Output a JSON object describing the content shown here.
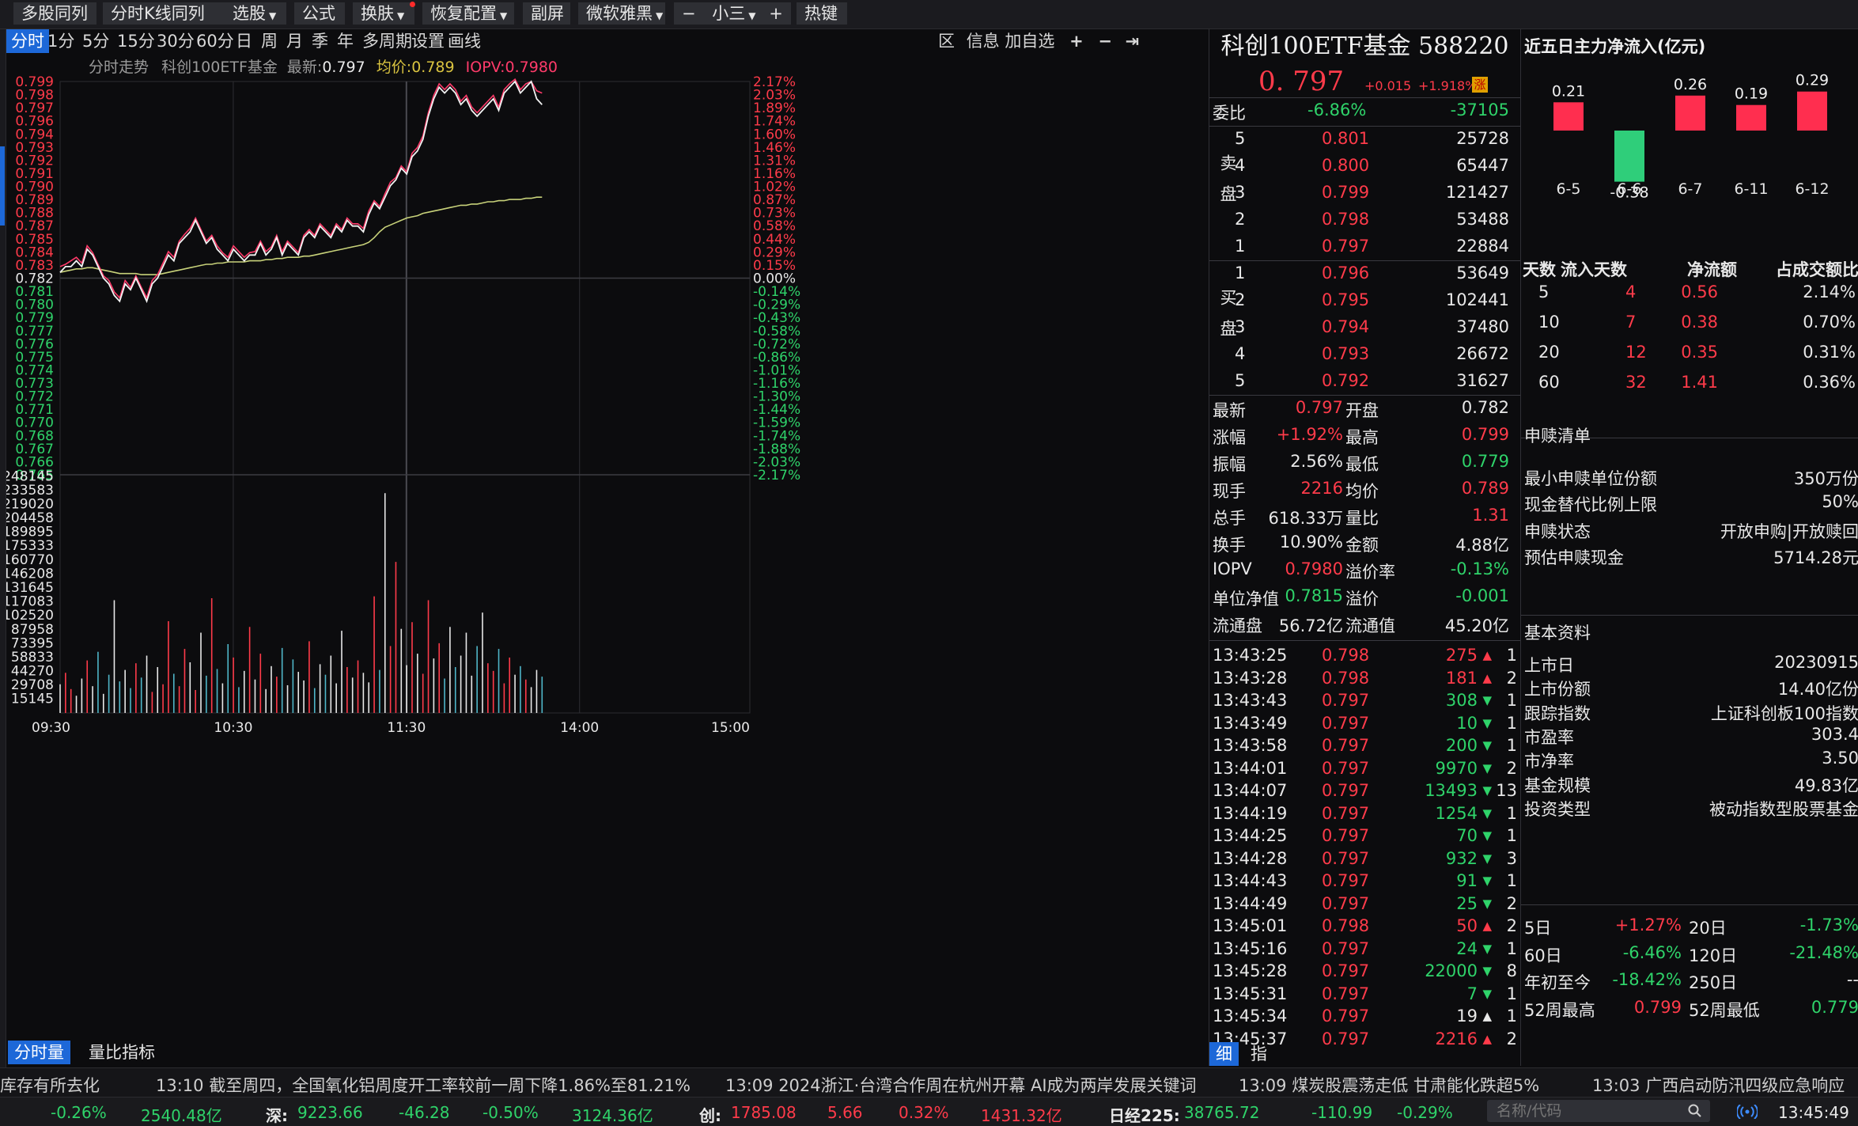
{
  "colors": {
    "up": "#ff3b4a",
    "down": "#2fd36a",
    "accent": "#1d68d8",
    "price_line": "#f2f2f2",
    "iopv_line": "#ff3b6a",
    "avg_line": "#c8d27a"
  },
  "toolbar": {
    "buttons": [
      {
        "label": "多股同列",
        "dropdown": false
      },
      {
        "label": "分时K线同列",
        "dropdown": false
      },
      {
        "label": "选股",
        "dropdown": true
      },
      {
        "label": "公式",
        "dropdown": false
      },
      {
        "label": "换肤",
        "dropdown": true
      },
      {
        "label": "恢复配置",
        "dropdown": true
      },
      {
        "label": "副屏",
        "dropdown": false
      },
      {
        "label": "微软雅黑",
        "dropdown": true
      },
      {
        "label": "小三",
        "dropdown": true
      },
      {
        "label": "热键",
        "dropdown": false
      }
    ],
    "minus": "−",
    "plus": "+"
  },
  "period_tabs": [
    "分时",
    "1分",
    "5分",
    "15分",
    "30分",
    "60分",
    "日",
    "周",
    "月",
    "季",
    "年",
    "多周期",
    "设置",
    "画线"
  ],
  "chart_toolbar": {
    "zone": "区",
    "info": "信息",
    "add_watch": "加自选",
    "plus": "+",
    "minus": "−",
    "arrow": "⇥"
  },
  "chart_header": {
    "title": "分时走势",
    "name": "科创100ETF基金",
    "latest_label": "最新:",
    "latest": "0.797",
    "avg_label": "均价:",
    "avg": "0.789",
    "iopv_label": "IOPV:",
    "iopv": "0.7980"
  },
  "chart_data": {
    "type": "line",
    "base_price": 0.782,
    "price_ticks": [
      "0.799",
      "0.798",
      "0.797",
      "0.796",
      "0.794",
      "0.793",
      "0.792",
      "0.791",
      "0.790",
      "0.789",
      "0.788",
      "0.787",
      "0.785",
      "0.784",
      "0.783",
      "0.782",
      "0.781",
      "0.780",
      "0.779",
      "0.777",
      "0.776",
      "0.775",
      "0.774",
      "0.773",
      "0.772",
      "0.771",
      "0.770",
      "0.768",
      "0.767",
      "0.766",
      "0.765"
    ],
    "pct_ticks": [
      "2.17%",
      "2.03%",
      "1.89%",
      "1.74%",
      "1.60%",
      "1.46%",
      "1.31%",
      "1.16%",
      "1.02%",
      "0.87%",
      "0.73%",
      "0.58%",
      "0.44%",
      "0.29%",
      "0.15%",
      "0.00%",
      "-0.14%",
      "-0.29%",
      "-0.43%",
      "-0.58%",
      "-0.72%",
      "-0.86%",
      "-1.01%",
      "-1.16%",
      "-1.30%",
      "-1.44%",
      "-1.59%",
      "-1.74%",
      "-1.88%",
      "-2.03%",
      "-2.17%"
    ],
    "volume_ticks": [
      "248145",
      "233583",
      "219020",
      "204458",
      "189895",
      "175333",
      "160770",
      "146208",
      "131645",
      "117083",
      "102520",
      "87958",
      "73395",
      "58833",
      "44270",
      "29708",
      "15145"
    ],
    "time_labels": [
      "09:30",
      "10:30",
      "11:30",
      "14:00",
      "15:00"
    ],
    "price_series": [
      0.7825,
      0.783,
      0.783,
      0.7835,
      0.783,
      0.7845,
      0.784,
      0.783,
      0.782,
      0.7815,
      0.7805,
      0.78,
      0.7815,
      0.781,
      0.782,
      0.781,
      0.78,
      0.7815,
      0.782,
      0.783,
      0.784,
      0.7835,
      0.785,
      0.7855,
      0.786,
      0.787,
      0.786,
      0.785,
      0.7855,
      0.7845,
      0.784,
      0.7835,
      0.7845,
      0.784,
      0.7835,
      0.784,
      0.784,
      0.785,
      0.784,
      0.7845,
      0.7855,
      0.784,
      0.785,
      0.7845,
      0.784,
      0.7855,
      0.786,
      0.7855,
      0.7865,
      0.786,
      0.7855,
      0.7865,
      0.786,
      0.787,
      0.7865,
      0.7865,
      0.786,
      0.7875,
      0.7885,
      0.788,
      0.789,
      0.79,
      0.7905,
      0.7915,
      0.791,
      0.7925,
      0.793,
      0.794,
      0.796,
      0.7975,
      0.7985,
      0.798,
      0.7985,
      0.798,
      0.797,
      0.7975,
      0.7965,
      0.796,
      0.7965,
      0.797,
      0.7975,
      0.7965,
      0.798,
      0.7985,
      0.799,
      0.798,
      0.7985,
      0.799,
      0.7975,
      0.797
    ],
    "iopv_series": [
      0.783,
      0.7832,
      0.7835,
      0.7838,
      0.7833,
      0.7848,
      0.7842,
      0.7832,
      0.7822,
      0.7818,
      0.7808,
      0.7803,
      0.7818,
      0.7812,
      0.7822,
      0.7812,
      0.7803,
      0.7818,
      0.7823,
      0.7833,
      0.7843,
      0.7838,
      0.7852,
      0.7858,
      0.7863,
      0.7872,
      0.7862,
      0.7852,
      0.7857,
      0.7848,
      0.7842,
      0.7838,
      0.7848,
      0.7843,
      0.7838,
      0.7842,
      0.7843,
      0.7852,
      0.7843,
      0.7847,
      0.7857,
      0.7843,
      0.7852,
      0.7847,
      0.7842,
      0.7857,
      0.7862,
      0.7857,
      0.7867,
      0.7862,
      0.7857,
      0.7867,
      0.7862,
      0.7872,
      0.7867,
      0.7867,
      0.7863,
      0.7878,
      0.7887,
      0.7882,
      0.7893,
      0.7903,
      0.7907,
      0.7917,
      0.7912,
      0.7928,
      0.7933,
      0.7943,
      0.7963,
      0.7978,
      0.7988,
      0.7983,
      0.7988,
      0.7983,
      0.7973,
      0.7978,
      0.7968,
      0.7963,
      0.7968,
      0.7973,
      0.7978,
      0.7968,
      0.7983,
      0.7988,
      0.7992,
      0.7983,
      0.7988,
      0.799,
      0.7982,
      0.798
    ],
    "avg_series": [
      0.7825,
      0.7826,
      0.7827,
      0.7828,
      0.7828,
      0.7829,
      0.7829,
      0.7828,
      0.7827,
      0.7826,
      0.7825,
      0.7824,
      0.7824,
      0.7824,
      0.7824,
      0.7823,
      0.7823,
      0.7823,
      0.7823,
      0.7824,
      0.7825,
      0.7826,
      0.7827,
      0.7828,
      0.7829,
      0.783,
      0.7831,
      0.7832,
      0.7832,
      0.7833,
      0.7833,
      0.7834,
      0.7834,
      0.7834,
      0.7834,
      0.7835,
      0.7835,
      0.7835,
      0.7836,
      0.7836,
      0.7837,
      0.7837,
      0.7838,
      0.7838,
      0.7838,
      0.7839,
      0.7839,
      0.784,
      0.7841,
      0.7842,
      0.7843,
      0.7844,
      0.7845,
      0.7846,
      0.7847,
      0.7848,
      0.7849,
      0.7851,
      0.7855,
      0.786,
      0.7864,
      0.7866,
      0.7868,
      0.787,
      0.7872,
      0.7873,
      0.7874,
      0.7876,
      0.7877,
      0.7878,
      0.7879,
      0.788,
      0.7881,
      0.7882,
      0.7883,
      0.7883,
      0.7884,
      0.7884,
      0.7885,
      0.7886,
      0.7886,
      0.7887,
      0.7887,
      0.7888,
      0.7888,
      0.7888,
      0.7889,
      0.7889,
      0.789,
      0.789
    ],
    "volume_series": [
      30000,
      42000,
      25000,
      18000,
      36000,
      55000,
      28000,
      64000,
      20000,
      40000,
      118000,
      33000,
      45000,
      26000,
      52000,
      37000,
      60000,
      22000,
      48000,
      30000,
      96000,
      41000,
      28000,
      67000,
      53000,
      24000,
      84000,
      39000,
      120000,
      46000,
      31000,
      72000,
      58000,
      27000,
      44000,
      90000,
      35000,
      62000,
      25000,
      49000,
      38000,
      68000,
      29000,
      56000,
      43000,
      34000,
      75000,
      26000,
      51000,
      40000,
      60000,
      31000,
      86000,
      48000,
      37000,
      55000,
      42000,
      32000,
      122000,
      45000,
      230000,
      70000,
      158000,
      88000,
      50000,
      95000,
      62000,
      41000,
      118000,
      57000,
      73000,
      36000,
      90000,
      48000,
      60000,
      84000,
      39000,
      70000,
      105000,
      52000,
      44000,
      67000,
      31000,
      58000,
      40000,
      49000,
      35000,
      27000,
      45000,
      38000
    ]
  },
  "chart_bottom_tabs": [
    "分时量",
    "量比指标"
  ],
  "quote": {
    "title": "科创100ETF基金 588220",
    "price": "0. 797",
    "change": "+0.015",
    "pct": "+1.918%",
    "badge": "涨",
    "weibi_label": "委比",
    "weibi_pct": "-6.86%",
    "weibi_val": "-37105",
    "sell_label": "卖盘",
    "buy_label": "买盘",
    "sells": [
      {
        "lvl": "5",
        "price": "0.801",
        "vol": "25728"
      },
      {
        "lvl": "4",
        "price": "0.800",
        "vol": "65447"
      },
      {
        "lvl": "3",
        "price": "0.799",
        "vol": "121427"
      },
      {
        "lvl": "2",
        "price": "0.798",
        "vol": "53488"
      },
      {
        "lvl": "1",
        "price": "0.797",
        "vol": "22884"
      }
    ],
    "buys": [
      {
        "lvl": "1",
        "price": "0.796",
        "vol": "53649"
      },
      {
        "lvl": "2",
        "price": "0.795",
        "vol": "102441"
      },
      {
        "lvl": "3",
        "price": "0.794",
        "vol": "37480"
      },
      {
        "lvl": "4",
        "price": "0.793",
        "vol": "26672"
      },
      {
        "lvl": "5",
        "price": "0.792",
        "vol": "31627"
      }
    ],
    "stats": [
      {
        "l1": "最新",
        "v1": "0.797",
        "c1": "red",
        "l2": "开盘",
        "v2": "0.782",
        "c2": "white"
      },
      {
        "l1": "涨幅",
        "v1": "+1.92%",
        "c1": "red",
        "l2": "最高",
        "v2": "0.799",
        "c2": "red"
      },
      {
        "l1": "振幅",
        "v1": "2.56%",
        "c1": "white",
        "l2": "最低",
        "v2": "0.779",
        "c2": "green"
      },
      {
        "l1": "现手",
        "v1": "2216",
        "c1": "red",
        "l2": "均价",
        "v2": "0.789",
        "c2": "red"
      },
      {
        "l1": "总手",
        "v1": "618.33万",
        "c1": "white",
        "l2": "量比",
        "v2": "1.31",
        "c2": "red"
      },
      {
        "l1": "换手",
        "v1": "10.90%",
        "c1": "white",
        "l2": "金额",
        "v2": "4.88亿",
        "c2": "white"
      },
      {
        "l1": "IOPV",
        "v1": "0.7980",
        "c1": "red",
        "l2": "溢价率",
        "v2": "-0.13%",
        "c2": "green"
      },
      {
        "l1": "单位净值",
        "v1": "0.7815",
        "c1": "green",
        "l2": "溢价",
        "v2": "-0.001",
        "c2": "green"
      },
      {
        "l1": "流通盘",
        "v1": "56.72亿",
        "c1": "white",
        "l2": "流通值",
        "v2": "45.20亿",
        "c2": "white"
      }
    ],
    "ticks": [
      {
        "t": "13:43:25",
        "p": "0.798",
        "pc": "red",
        "v": "275",
        "dir": "up",
        "n": "1"
      },
      {
        "t": "13:43:28",
        "p": "0.798",
        "pc": "red",
        "v": "181",
        "dir": "up",
        "n": "2"
      },
      {
        "t": "13:43:43",
        "p": "0.797",
        "pc": "red",
        "v": "308",
        "dir": "down",
        "n": "1"
      },
      {
        "t": "13:43:49",
        "p": "0.797",
        "pc": "red",
        "v": "10",
        "dir": "down",
        "n": "1"
      },
      {
        "t": "13:43:58",
        "p": "0.797",
        "pc": "red",
        "v": "200",
        "dir": "down",
        "n": "1"
      },
      {
        "t": "13:44:01",
        "p": "0.797",
        "pc": "red",
        "v": "9970",
        "dir": "down",
        "n": "2"
      },
      {
        "t": "13:44:07",
        "p": "0.797",
        "pc": "red",
        "v": "13493",
        "dir": "down",
        "n": "13"
      },
      {
        "t": "13:44:19",
        "p": "0.797",
        "pc": "red",
        "v": "1254",
        "dir": "down",
        "n": "1"
      },
      {
        "t": "13:44:25",
        "p": "0.797",
        "pc": "red",
        "v": "70",
        "dir": "down",
        "n": "1"
      },
      {
        "t": "13:44:28",
        "p": "0.797",
        "pc": "red",
        "v": "932",
        "dir": "down",
        "n": "3"
      },
      {
        "t": "13:44:43",
        "p": "0.797",
        "pc": "red",
        "v": "91",
        "dir": "down",
        "n": "1"
      },
      {
        "t": "13:44:49",
        "p": "0.797",
        "pc": "red",
        "v": "25",
        "dir": "down",
        "n": "2"
      },
      {
        "t": "13:45:01",
        "p": "0.798",
        "pc": "red",
        "v": "50",
        "dir": "up",
        "n": "2"
      },
      {
        "t": "13:45:16",
        "p": "0.797",
        "pc": "red",
        "v": "24",
        "dir": "down",
        "n": "1"
      },
      {
        "t": "13:45:28",
        "p": "0.797",
        "pc": "red",
        "v": "22000",
        "dir": "down",
        "n": "8"
      },
      {
        "t": "13:45:31",
        "p": "0.797",
        "pc": "red",
        "v": "7",
        "dir": "down",
        "n": "1"
      },
      {
        "t": "13:45:34",
        "p": "0.797",
        "pc": "red",
        "v": "19",
        "dir": "neutral",
        "n": "1"
      },
      {
        "t": "13:45:37",
        "p": "0.797",
        "pc": "red",
        "v": "2216",
        "dir": "up",
        "n": "2"
      }
    ],
    "bottom_tabs": [
      "细",
      "指"
    ]
  },
  "flow": {
    "title": "近五日主力净流入(亿元)",
    "bars": [
      {
        "date": "6-5",
        "value": 0.21
      },
      {
        "date": "6-6",
        "value": -0.38
      },
      {
        "date": "6-7",
        "value": 0.26
      },
      {
        "date": "6-11",
        "value": 0.19
      },
      {
        "date": "6-12",
        "value": 0.29
      }
    ],
    "headers": [
      "天数",
      "流入天数",
      "净流额",
      "占成交额比"
    ],
    "rows": [
      [
        "5",
        "4",
        "0.56",
        "2.14%"
      ],
      [
        "10",
        "7",
        "0.38",
        "0.70%"
      ],
      [
        "20",
        "12",
        "0.35",
        "0.31%"
      ],
      [
        "60",
        "32",
        "1.41",
        "0.36%"
      ]
    ]
  },
  "subscription": {
    "title": "申赎清单",
    "items": [
      {
        "label": "最小申赎单位份额",
        "value": "350万份"
      },
      {
        "label": "现金替代比例上限",
        "value": "50%"
      },
      {
        "label": "申赎状态",
        "value": "开放申购|开放赎回"
      },
      {
        "label": "预估申赎现金",
        "value": "5714.28元"
      }
    ]
  },
  "basic": {
    "title": "基本资料",
    "items": [
      {
        "label": "上市日",
        "value": "20230915"
      },
      {
        "label": "上市份额",
        "value": "14.40亿份"
      },
      {
        "label": "跟踪指数",
        "value": "上证科创板100指数"
      },
      {
        "label": "市盈率",
        "value": "303.4"
      },
      {
        "label": "市净率",
        "value": "3.50"
      },
      {
        "label": "基金规模",
        "value": "49.83亿"
      },
      {
        "label": "投资类型",
        "value": "被动指数型股票基金"
      }
    ]
  },
  "periods": [
    {
      "l1": "5日",
      "v1": "+1.27%",
      "c1": "red",
      "l2": "20日",
      "v2": "-1.73%",
      "c2": "green"
    },
    {
      "l1": "60日",
      "v1": "-6.46%",
      "c1": "green",
      "l2": "120日",
      "v2": "-21.48%",
      "c2": "green"
    },
    {
      "l1": "年初至今",
      "v1": "-18.42%",
      "c1": "green",
      "l2": "250日",
      "v2": "--",
      "c2": "white"
    },
    {
      "l1": "52周最高",
      "v1": "0.799",
      "c1": "red",
      "l2": "52周最低",
      "v2": "0.779",
      "c2": "green"
    }
  ],
  "news": [
    "库存有所去化",
    "13:10 截至周四，全国氧化铝周度开工率较前一周下降1.86%至81.21%",
    "13:09 2024浙江·台湾合作周在杭州开幕 AI成为两岸发展关键词",
    "13:09 煤炭股震荡走低 甘肃能化跌超5%",
    "13:03 广西启动防汛四级应急响应"
  ],
  "indices": {
    "i1": {
      "pct": "-0.26%",
      "amt": "2540.48亿"
    },
    "i2": {
      "name": "深:",
      "val": "9223.66",
      "chg": "-46.28",
      "pct": "-0.50%",
      "amt": "3124.36亿"
    },
    "i3": {
      "name": "创:",
      "val": "1785.08",
      "chg": "5.66",
      "pct": "0.32%",
      "amt": "1431.32亿"
    },
    "i4": {
      "name": "日经225:",
      "val": "38765.72",
      "chg": "-110.99",
      "pct": "-0.29%"
    },
    "search_placeholder": "名称/代码",
    "clock": "13:45:49"
  }
}
